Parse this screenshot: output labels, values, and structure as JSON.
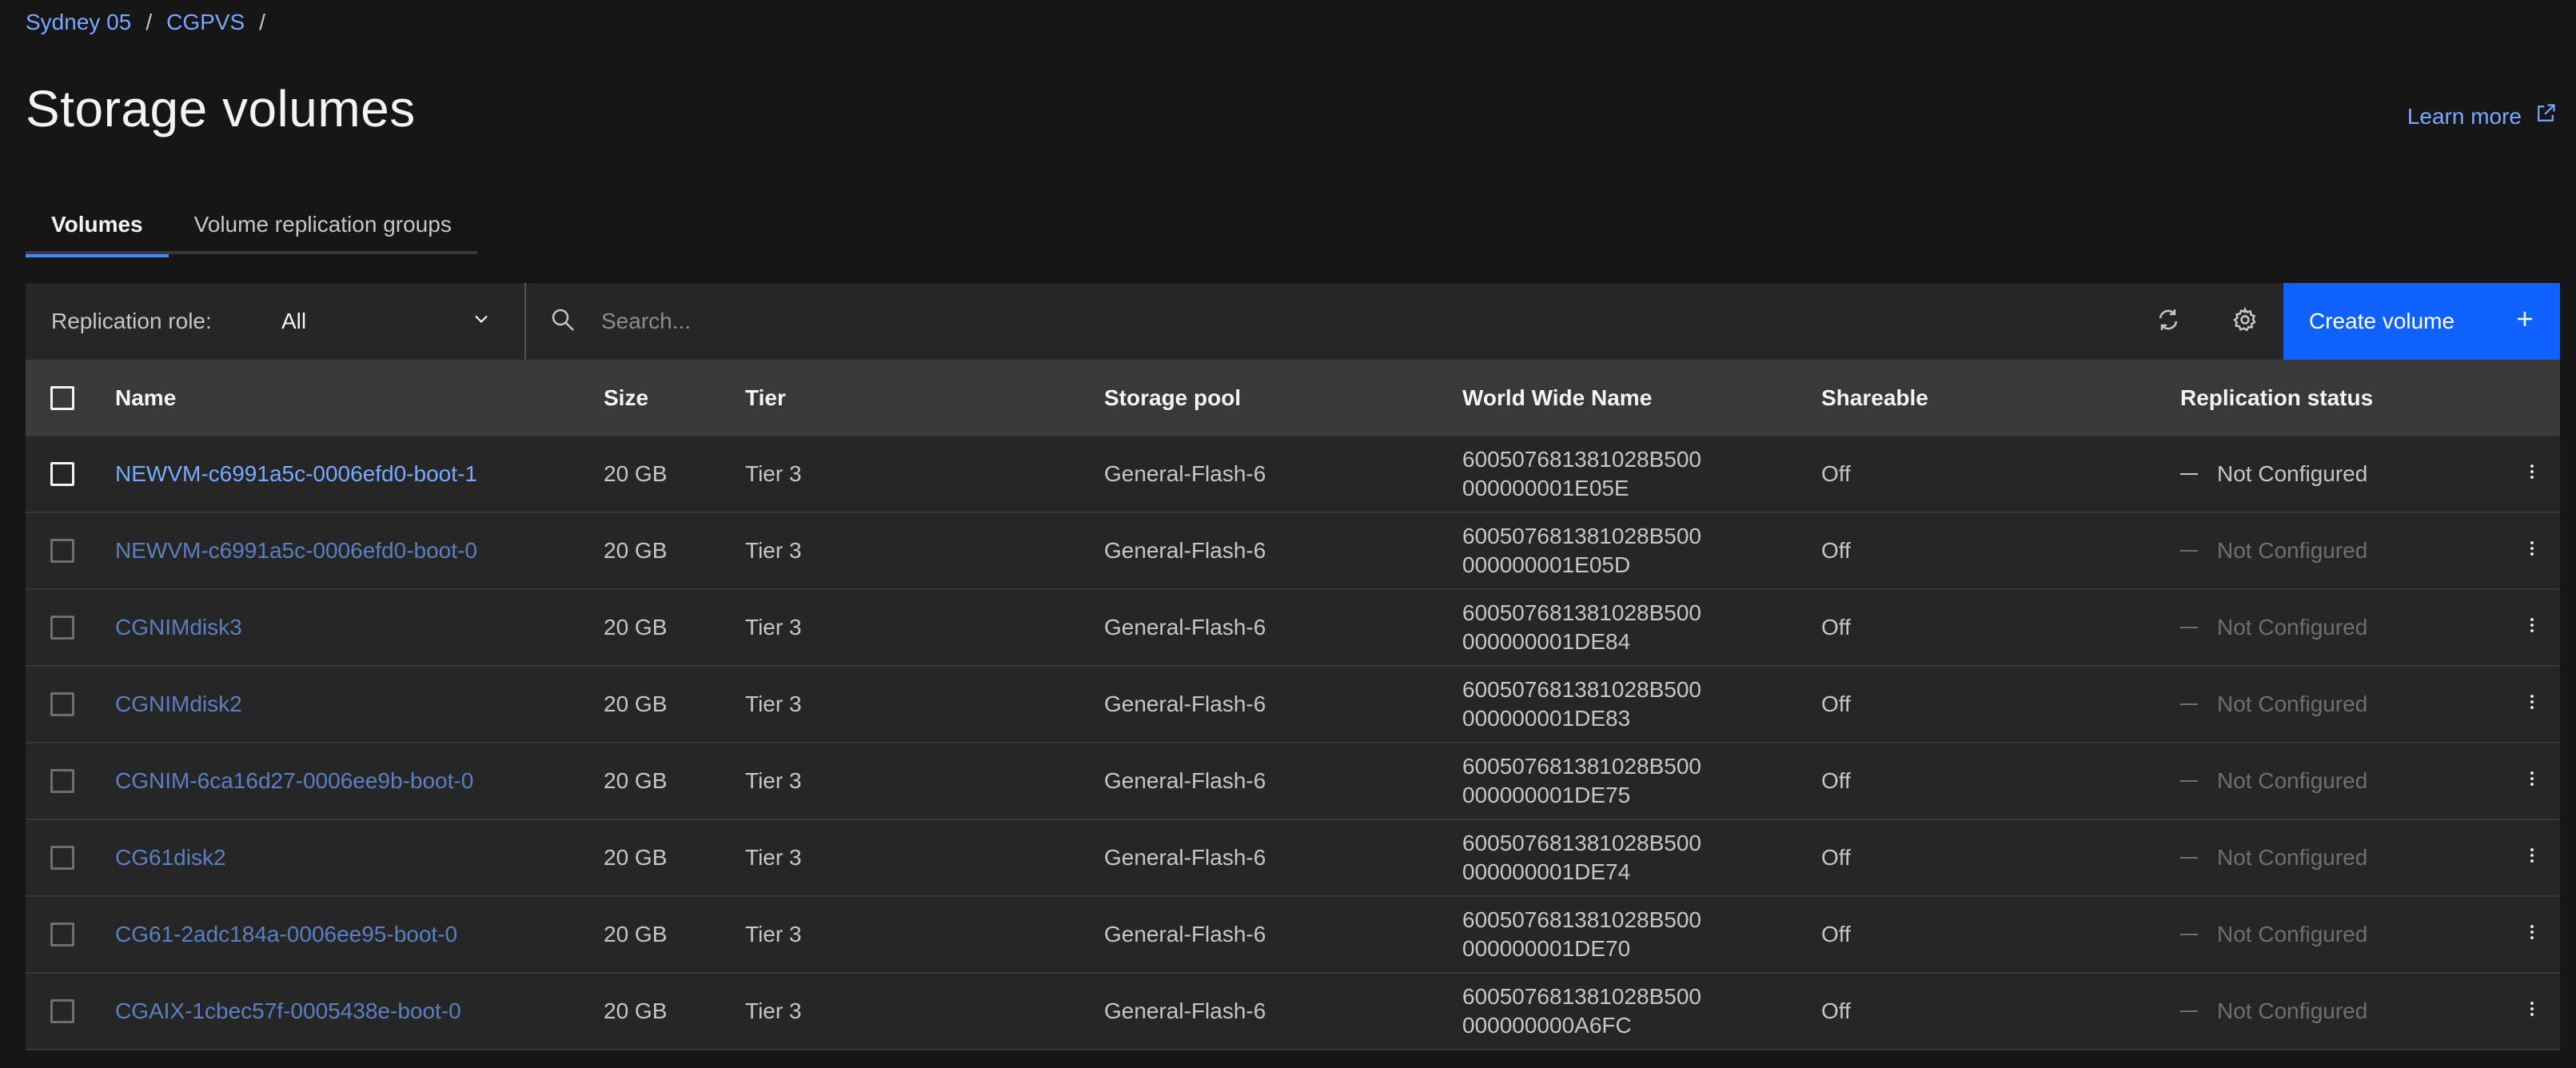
{
  "breadcrumb": {
    "items": [
      "Sydney 05",
      "CGPVS"
    ],
    "separator": "/"
  },
  "page_title": "Storage volumes",
  "learn_more": "Learn more",
  "tabs": [
    {
      "label": "Volumes",
      "active": true
    },
    {
      "label": "Volume replication groups",
      "active": false
    }
  ],
  "toolbar": {
    "filter_label": "Replication role:",
    "filter_value": "All",
    "search_placeholder": "Search...",
    "create_label": "Create volume"
  },
  "table": {
    "headers": {
      "name": "Name",
      "size": "Size",
      "tier": "Tier",
      "pool": "Storage pool",
      "wwn": "World Wide Name",
      "shareable": "Shareable",
      "replication": "Replication status"
    },
    "rows": [
      {
        "name": "NEWVM-c6991a5c-0006efd0-boot-1",
        "size": "20 GB",
        "tier": "Tier 3",
        "pool": "General-Flash-6",
        "wwn1": "600507681381028B500",
        "wwn2": "000000001E05E",
        "shareable": "Off",
        "replication": "Not Configured",
        "enabled": true
      },
      {
        "name": "NEWVM-c6991a5c-0006efd0-boot-0",
        "size": "20 GB",
        "tier": "Tier 3",
        "pool": "General-Flash-6",
        "wwn1": "600507681381028B500",
        "wwn2": "000000001E05D",
        "shareable": "Off",
        "replication": "Not Configured",
        "enabled": false
      },
      {
        "name": "CGNIMdisk3",
        "size": "20 GB",
        "tier": "Tier 3",
        "pool": "General-Flash-6",
        "wwn1": "600507681381028B500",
        "wwn2": "000000001DE84",
        "shareable": "Off",
        "replication": "Not Configured",
        "enabled": false
      },
      {
        "name": "CGNIMdisk2",
        "size": "20 GB",
        "tier": "Tier 3",
        "pool": "General-Flash-6",
        "wwn1": "600507681381028B500",
        "wwn2": "000000001DE83",
        "shareable": "Off",
        "replication": "Not Configured",
        "enabled": false
      },
      {
        "name": "CGNIM-6ca16d27-0006ee9b-boot-0",
        "size": "20 GB",
        "tier": "Tier 3",
        "pool": "General-Flash-6",
        "wwn1": "600507681381028B500",
        "wwn2": "000000001DE75",
        "shareable": "Off",
        "replication": "Not Configured",
        "enabled": false
      },
      {
        "name": "CG61disk2",
        "size": "20 GB",
        "tier": "Tier 3",
        "pool": "General-Flash-6",
        "wwn1": "600507681381028B500",
        "wwn2": "000000001DE74",
        "shareable": "Off",
        "replication": "Not Configured",
        "enabled": false
      },
      {
        "name": "CG61-2adc184a-0006ee95-boot-0",
        "size": "20 GB",
        "tier": "Tier 3",
        "pool": "General-Flash-6",
        "wwn1": "600507681381028B500",
        "wwn2": "000000001DE70",
        "shareable": "Off",
        "replication": "Not Configured",
        "enabled": false
      },
      {
        "name": "CGAIX-1cbec57f-0005438e-boot-0",
        "size": "20 GB",
        "tier": "Tier 3",
        "pool": "General-Flash-6",
        "wwn1": "600507681381028B500",
        "wwn2": "000000000A6FC",
        "shareable": "Off",
        "replication": "Not Configured",
        "enabled": false
      }
    ]
  },
  "colors": {
    "background": "#161616",
    "link": "#78a9ff",
    "primary_button": "#0f62fe",
    "active_tab_indicator": "#4589ff"
  },
  "icons": {
    "learn_more": "launch-icon",
    "filter": "chevron-down-icon",
    "search": "search-icon",
    "refresh": "refresh-icon",
    "settings": "gear-icon",
    "create": "add-icon",
    "row_menu": "overflow-menu-icon"
  }
}
